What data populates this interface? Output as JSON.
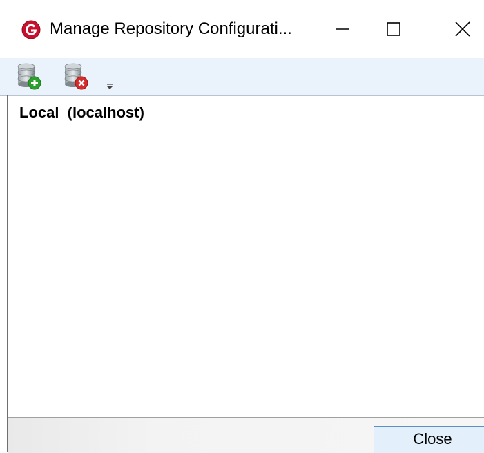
{
  "window": {
    "title": "Manage Repository Configurati...",
    "controls": {
      "minimize": "minimize",
      "maximize": "maximize",
      "close": "close"
    }
  },
  "toolbar": {
    "items": [
      {
        "name": "add-repository",
        "icon": "database-add-icon"
      },
      {
        "name": "remove-repository",
        "icon": "database-remove-icon"
      },
      {
        "name": "overflow",
        "icon": "chevron-down-icon"
      }
    ]
  },
  "repositories": [
    {
      "label": "Local  (localhost)"
    }
  ],
  "footer": {
    "close_label": "Close"
  },
  "colors": {
    "toolbar_bg": "#eaf2fb",
    "app_icon_red": "#c8102e",
    "add_green": "#2aa12a",
    "remove_red": "#d62b2b",
    "button_border": "#5a8fc7"
  }
}
